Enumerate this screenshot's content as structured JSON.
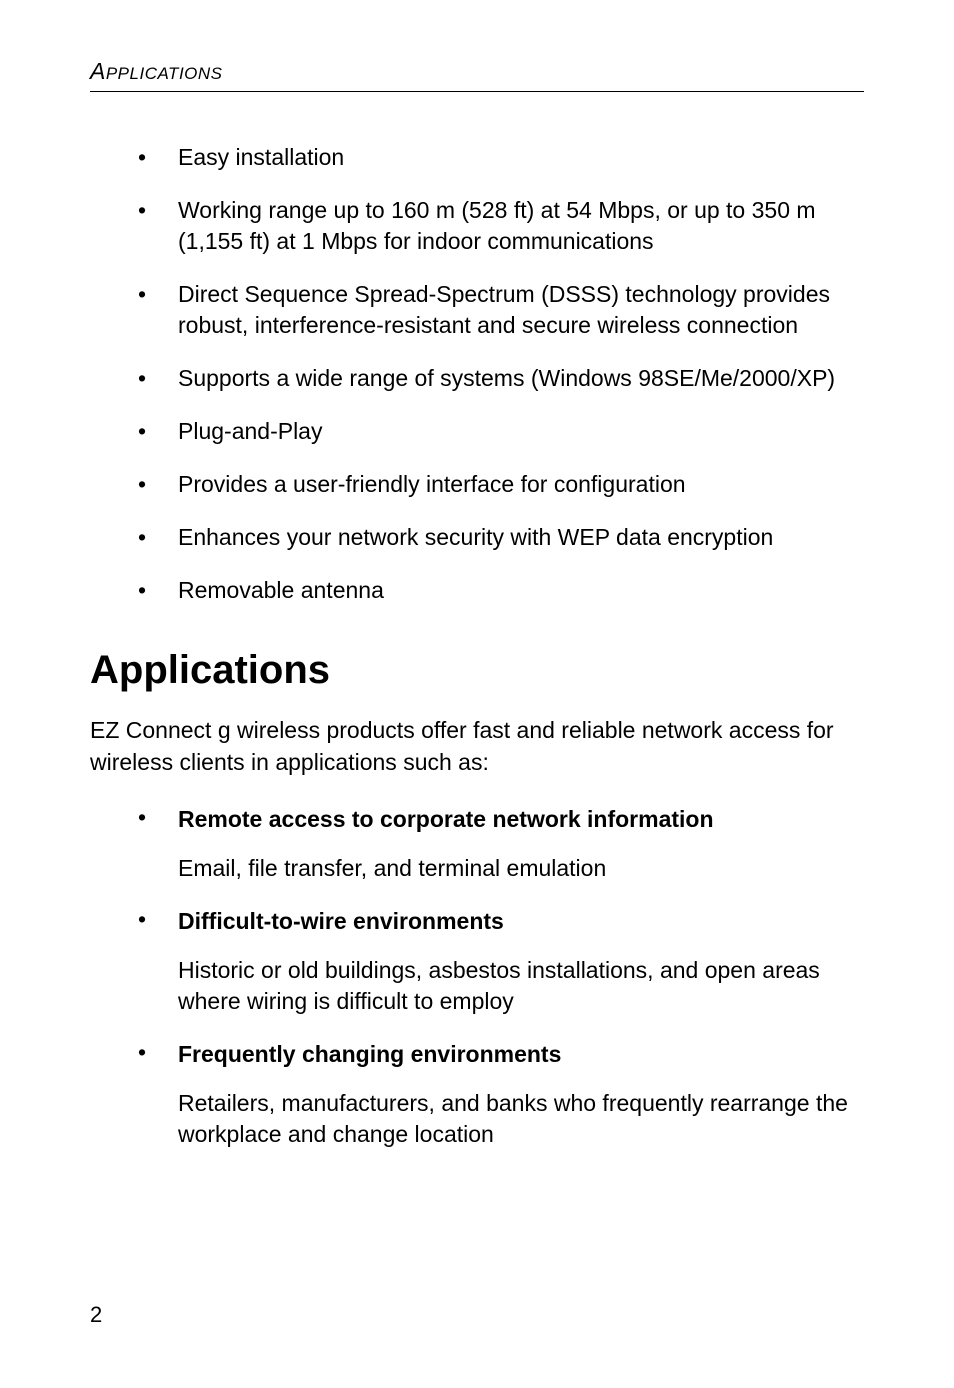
{
  "header": {
    "first_char": "A",
    "rest": "PPLICATIONS"
  },
  "features": [
    "Easy installation",
    "Working range up to 160 m (528 ft) at 54 Mbps, or up to 350 m (1,155 ft) at 1 Mbps for indoor communications",
    "Direct Sequence Spread-Spectrum (DSSS) technology provides robust, interference-resistant and secure wireless connection",
    "Supports a wide range of systems (Windows 98SE/Me/2000/XP)",
    "Plug-and-Play",
    "Provides a user-friendly interface for configuration",
    "Enhances your network security with WEP data encryption",
    "Removable antenna"
  ],
  "section_heading": "Applications",
  "intro": "EZ Connect g wireless products offer fast and reliable network access for wireless clients in applications such as:",
  "applications": [
    {
      "title": "Remote access to corporate network information",
      "desc": "Email, file transfer, and terminal emulation"
    },
    {
      "title": "Difficult-to-wire environments",
      "desc": "Historic or old buildings, asbestos installations, and open areas where wiring is difficult to employ"
    },
    {
      "title": "Frequently changing environments",
      "desc": "Retailers, manufacturers, and banks who frequently rearrange the workplace and change location"
    }
  ],
  "page_number": "2"
}
